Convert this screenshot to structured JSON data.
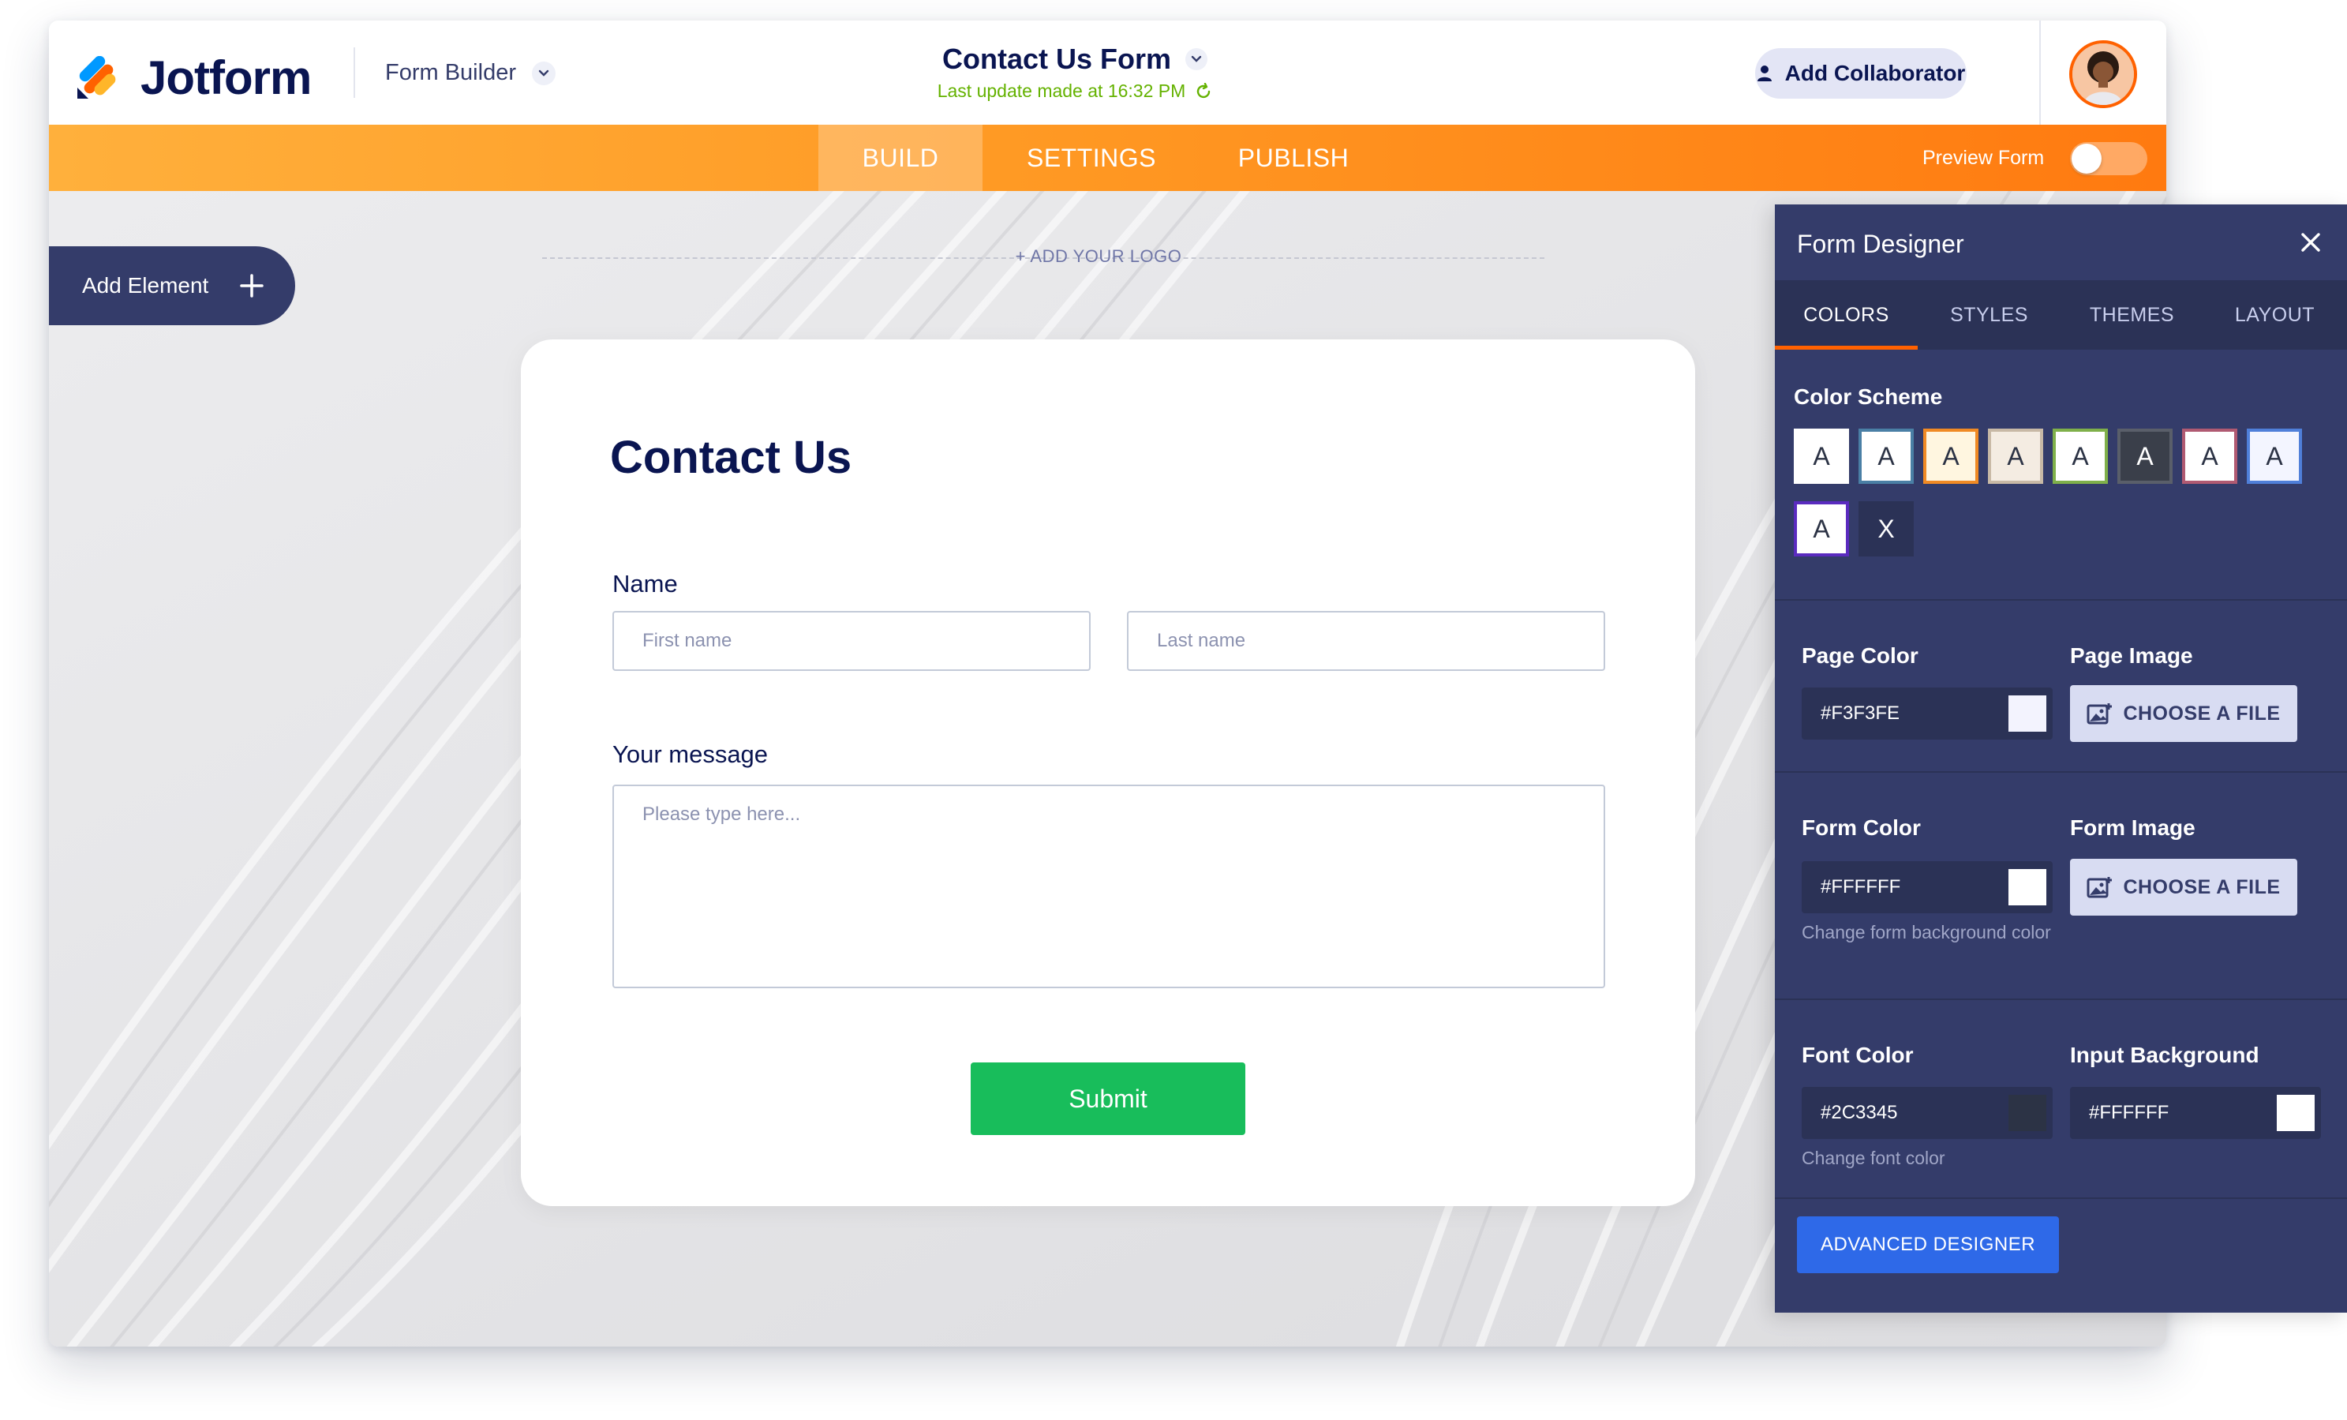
{
  "header": {
    "brand": "Jotform",
    "builder_label": "Form Builder",
    "form_title": "Contact Us Form",
    "last_update": "Last update made at 16:32 PM",
    "collaborator_button": "Add Collaborator"
  },
  "nav": {
    "tabs": [
      {
        "label": "BUILD",
        "active": true
      },
      {
        "label": "SETTINGS",
        "active": false
      },
      {
        "label": "PUBLISH",
        "active": false
      }
    ],
    "preview_label": "Preview Form",
    "preview_on": false
  },
  "canvas": {
    "add_element": "Add Element",
    "add_logo": "+ ADD YOUR LOGO"
  },
  "form": {
    "heading": "Contact Us",
    "name_label": "Name",
    "first_name_placeholder": "First name",
    "last_name_placeholder": "Last name",
    "message_label": "Your message",
    "message_placeholder": "Please type here...",
    "submit_label": "Submit"
  },
  "designer": {
    "title": "Form Designer",
    "tabs": [
      {
        "label": "COLORS",
        "active": true
      },
      {
        "label": "STYLES",
        "active": false
      },
      {
        "label": "THEMES",
        "active": false
      },
      {
        "label": "LAYOUT",
        "active": false
      }
    ],
    "color_scheme_label": "Color Scheme",
    "swatches": [
      {
        "letter": "A",
        "bg": "#ffffff",
        "fg": "#2c3345",
        "border": "#ffffff"
      },
      {
        "letter": "A",
        "bg": "#ffffff",
        "fg": "#2c3345",
        "border": "#4a7fa5"
      },
      {
        "letter": "A",
        "bg": "#fff6e0",
        "fg": "#2c3345",
        "border": "#f08a24"
      },
      {
        "letter": "A",
        "bg": "#f4ece2",
        "fg": "#2c3345",
        "border": "#c8b9a6"
      },
      {
        "letter": "A",
        "bg": "#ffffff",
        "fg": "#2c3345",
        "border": "#7fb04a"
      },
      {
        "letter": "A",
        "bg": "#3a3f4a",
        "fg": "#ffffff",
        "border": "#5a5f6a"
      },
      {
        "letter": "A",
        "bg": "#ffffff",
        "fg": "#2c3345",
        "border": "#b05a72"
      },
      {
        "letter": "A",
        "bg": "#f3f5ff",
        "fg": "#2c3345",
        "border": "#4f7fd9"
      },
      {
        "letter": "A",
        "bg": "#ffffff",
        "fg": "#2c3345",
        "border": "#5a2bbf"
      },
      {
        "letter": "X",
        "bg": "#2b3256",
        "fg": "#ffffff",
        "border": "#2b3256"
      }
    ],
    "page_color_label": "Page Color",
    "page_color_value": "#F3F3FE",
    "page_image_label": "Page Image",
    "choose_file": "CHOOSE A FILE",
    "form_color_label": "Form Color",
    "form_color_value": "#FFFFFF",
    "form_color_hint": "Change form background color",
    "form_image_label": "Form Image",
    "font_color_label": "Font Color",
    "font_color_value": "#2C3345",
    "font_color_hint": "Change font color",
    "input_bg_label": "Input Background",
    "input_bg_value": "#FFFFFF",
    "advanced_button": "ADVANCED DESIGNER"
  },
  "colors": {
    "brand_navy": "#0a1551",
    "orange": "#ff6100",
    "submit_green": "#18bd5b",
    "panel": "#343c6a",
    "advanced_blue": "#2e69e8"
  }
}
